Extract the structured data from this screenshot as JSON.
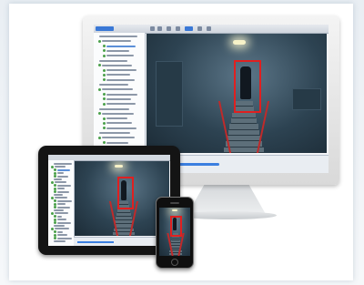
{
  "scene": {
    "description_visible_text": ""
  },
  "app": {
    "toolbar_buttons": [
      "back-icon",
      "forward-icon",
      "home-icon",
      "grid-icon",
      "play-icon",
      "pause-icon",
      "zoom-icon"
    ],
    "sidebar_items_count": 28,
    "selection_box_color": "#e02020",
    "accent_color": "#3b7fe0"
  },
  "playback": {
    "progress_fraction": 0.4
  }
}
